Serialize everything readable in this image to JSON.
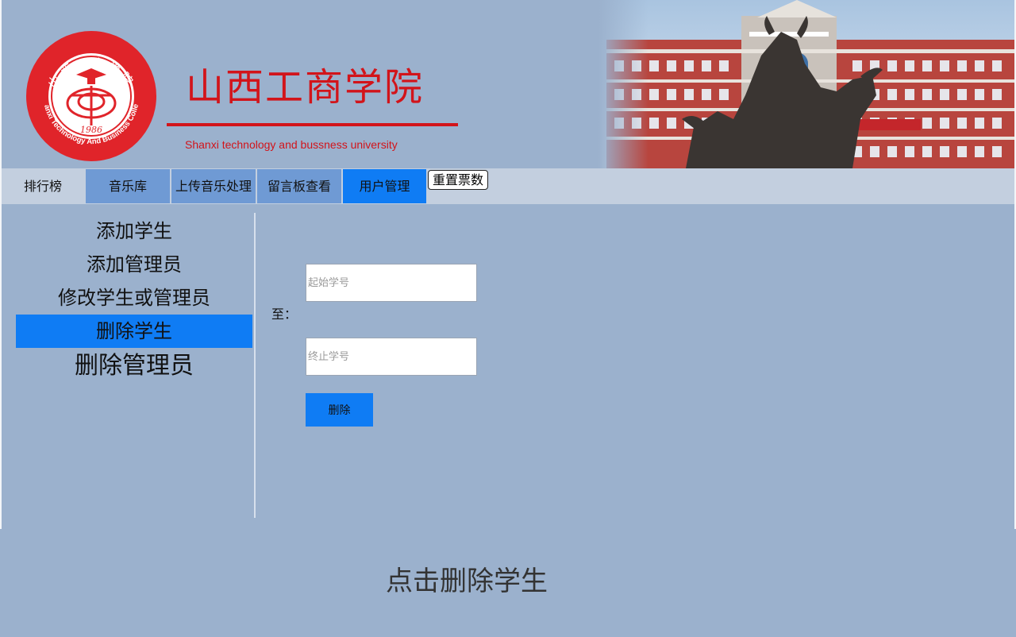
{
  "header": {
    "seal": {
      "arc_text_top": "山西工商学院",
      "arc_text_bottom": "Shanxi Technology And Business College",
      "year": "1986"
    },
    "title": "山西工商学院",
    "subtitle": "Shanxi technology and bussness university",
    "brand_color": "#d2141a"
  },
  "nav": {
    "items": [
      {
        "label": "排行榜"
      },
      {
        "label": "音乐库"
      },
      {
        "label": "上传音乐处理"
      },
      {
        "label": "留言板查看"
      },
      {
        "label": "用户管理"
      }
    ],
    "reset_label": "重置票数",
    "active_color": "#0f7cf4"
  },
  "sidebar": {
    "items": [
      {
        "label": "添加学生"
      },
      {
        "label": "添加管理员"
      },
      {
        "label": "修改学生或管理员"
      },
      {
        "label": "删除学生"
      },
      {
        "label": "删除管理员"
      }
    ],
    "active_index": 3
  },
  "form": {
    "to_label": "至：",
    "start_placeholder": "起始学号",
    "end_placeholder": "终止学号",
    "delete_label": "删除"
  },
  "footer": {
    "text": "点击删除学生"
  }
}
